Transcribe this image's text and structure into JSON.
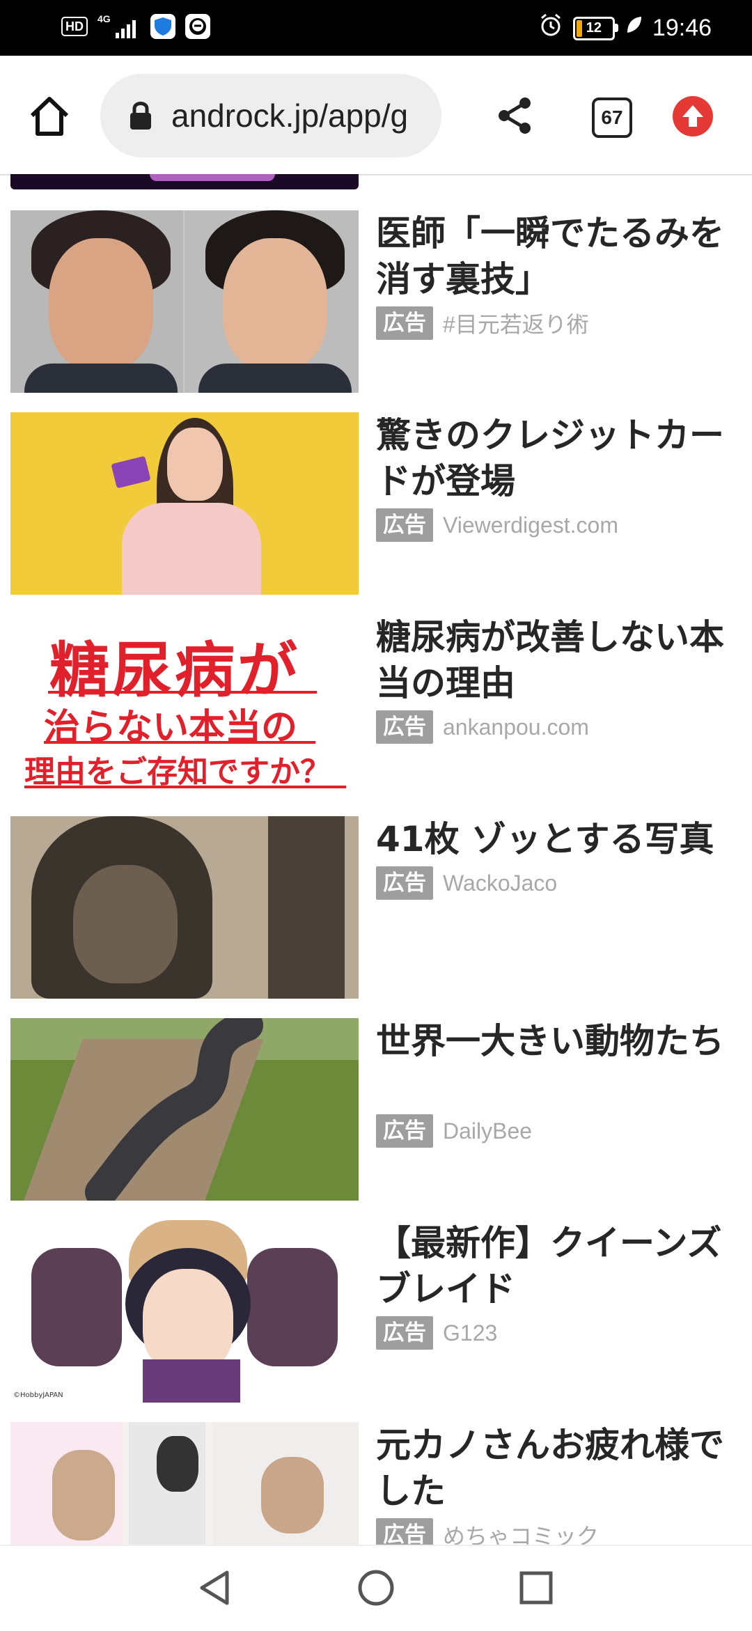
{
  "status_bar": {
    "hd_label": "HD",
    "network": "4G",
    "battery_level": "12",
    "time": "19:46"
  },
  "browser": {
    "url": "androck.jp/app/g",
    "tab_count": "67",
    "icons": {
      "home": "home-icon",
      "lock": "lock-icon",
      "share": "share-icon",
      "tabs": "tabs-counter-icon",
      "update": "update-arrow-icon"
    }
  },
  "ads": [
    {
      "title": "医師「一瞬でたるみを消す裏技」",
      "badge": "広告",
      "source": "#目元若返り術"
    },
    {
      "title": "驚きのクレジットカードが登場",
      "badge": "広告",
      "source": "Viewerdigest.com"
    },
    {
      "title": "糖尿病が改善しない本当の理由",
      "badge": "広告",
      "source": "ankanpou.com",
      "thumb_text": [
        "糖尿病が",
        "治らない本当の",
        "理由をご存知ですか？"
      ]
    },
    {
      "title": "41枚 ゾッとする写真",
      "badge": "広告",
      "source": "WackoJaco"
    },
    {
      "title": "世界一大きい動物たち",
      "badge": "広告",
      "source": "DailyBee"
    },
    {
      "title": "【最新作】クイーンズブレイド",
      "badge": "広告",
      "source": "G123",
      "thumb_caption": "©HobbyJAPAN"
    },
    {
      "title": "元カノさんお疲れ様でした",
      "badge": "広告",
      "source": "めちゃコミック"
    }
  ],
  "nav": {
    "back": "back-triangle-icon",
    "home": "home-circle-icon",
    "recents": "recents-square-icon"
  },
  "colors": {
    "accent_red": "#e53935",
    "badge_gray": "#9e9e9e",
    "title": "#262626"
  }
}
